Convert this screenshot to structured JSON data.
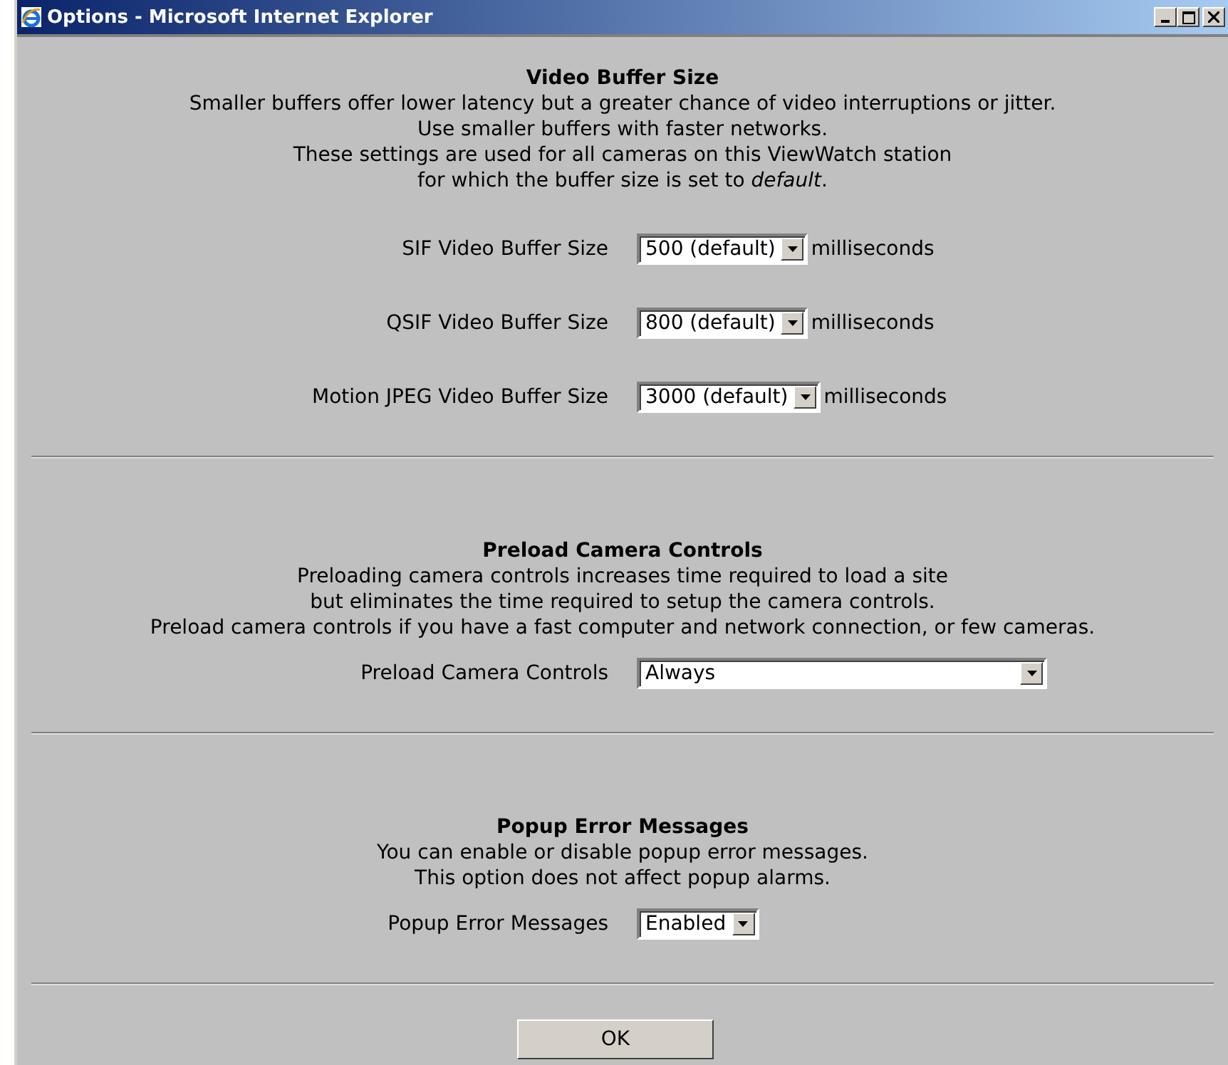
{
  "window": {
    "title": "Options - Microsoft Internet Explorer"
  },
  "sections": [
    {
      "title": "Video Buffer Size",
      "lines": [
        "Smaller buffers offer lower latency but a greater chance of video interruptions or jitter.",
        "Use smaller buffers with faster networks.",
        "These settings are used for all cameras on this ViewWatch station",
        "for which the buffer size is set to *default*."
      ],
      "fields": [
        {
          "label": "SIF Video Buffer Size",
          "value": "500 (default)",
          "unit": "milliseconds"
        },
        {
          "label": "QSIF Video Buffer Size",
          "value": "800 (default)",
          "unit": "milliseconds"
        },
        {
          "label": "Motion JPEG Video Buffer Size",
          "value": "3000 (default)",
          "unit": "milliseconds"
        }
      ]
    },
    {
      "title": "Preload Camera Controls",
      "lines": [
        "Preloading camera controls increases time required to load a site",
        "but eliminates the time required to setup the camera controls.",
        "Preload camera controls if you have a fast computer and network connection, or few cameras."
      ],
      "fields": [
        {
          "label": "Preload Camera Controls",
          "value": "Always",
          "wide": true
        }
      ]
    },
    {
      "title": "Popup Error Messages",
      "lines": [
        "You can enable or disable popup error messages.",
        "This option does not affect popup alarms."
      ],
      "fields": [
        {
          "label": "Popup Error Messages",
          "value": "Enabled"
        }
      ]
    }
  ],
  "ok_button": "OK"
}
